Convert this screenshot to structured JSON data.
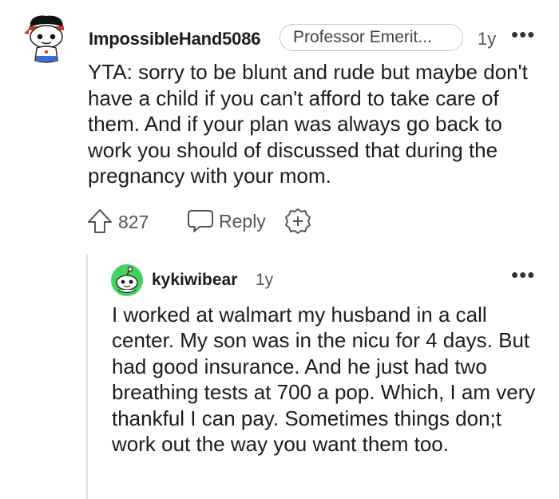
{
  "comment": {
    "username": "ImpossibleHand5086",
    "flair": "Professor Emerit...",
    "time": "1y",
    "more": "•••",
    "body": "YTA: sorry to be blunt and rude but maybe don't have a child if you can't afford to take care of them. And if your plan was always go back to work you should of discussed that during the pregnancy with your mom.",
    "votes": "827",
    "reply_label": "Reply",
    "icons": [
      "avatar",
      "upvote-icon",
      "reply-icon",
      "award-icon",
      "more-options-icon"
    ]
  },
  "reply": {
    "username": "kykiwibear",
    "time": "1y",
    "more": "•••",
    "body": "I worked at walmart my husband in a call center. My son was in the nicu for 4 days. But had good insurance. And he just had two breathing tests at 700 a pop. Which, I am very thankful I can pay. Sometimes things don;t work out the way you want them too.",
    "icons": [
      "avatar",
      "more-options-icon"
    ]
  },
  "colors": {
    "text": "#1c1c1c",
    "meta": "#555555",
    "thread_line": "#e1e1e1",
    "reply_avatar_green": "#46d160"
  }
}
